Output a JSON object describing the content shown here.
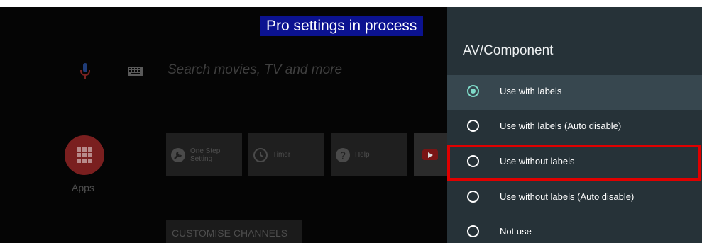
{
  "banner": {
    "text": "Pro settings in process"
  },
  "launcher": {
    "search_placeholder": "Search movies, TV and more",
    "apps_label": "Apps",
    "tiles": [
      {
        "label": "One Step\nSetting",
        "icon": "wrench-icon"
      },
      {
        "label": "Timer",
        "icon": "clock-icon"
      },
      {
        "label": "Help",
        "icon": "help-icon"
      },
      {
        "label": "",
        "icon": "youtube-icon"
      }
    ],
    "customise_label": "CUSTOMISE CHANNELS"
  },
  "panel": {
    "title": "AV/Component",
    "options": [
      {
        "label": "Use with labels",
        "selected": true
      },
      {
        "label": "Use with labels (Auto disable)",
        "selected": false
      },
      {
        "label": "Use without labels",
        "selected": false
      },
      {
        "label": "Use without labels (Auto disable)",
        "selected": false
      },
      {
        "label": "Not use",
        "selected": false
      }
    ]
  },
  "colors": {
    "panel_bg": "#263238",
    "selected_row": "#37474f",
    "radio_accent": "#7fdbc9",
    "banner_bg": "#0b1290",
    "highlight": "#e00000"
  }
}
